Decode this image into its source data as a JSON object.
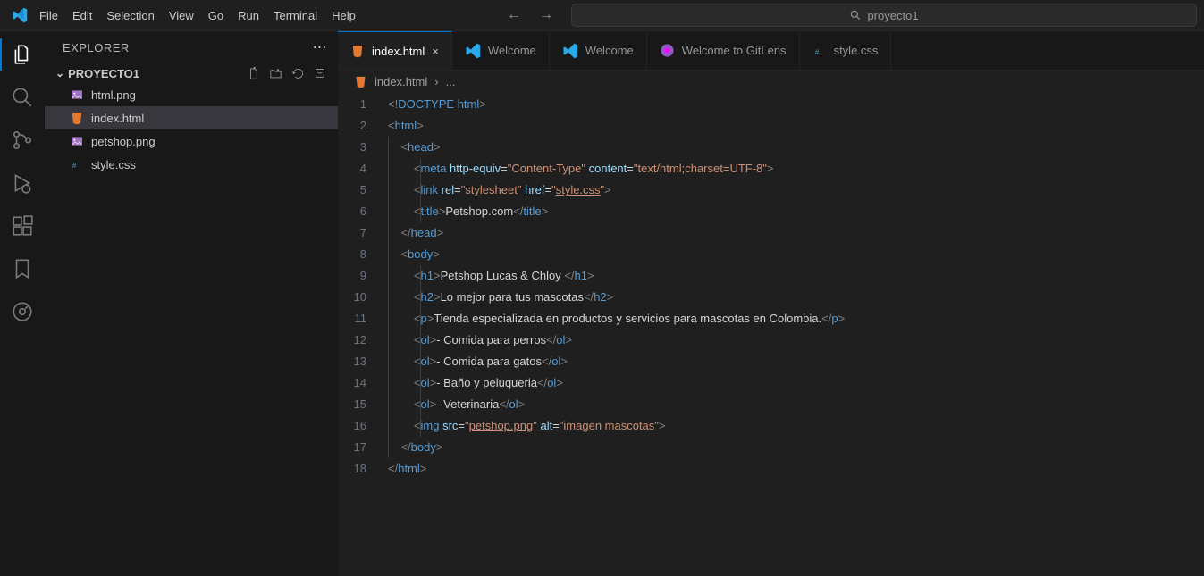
{
  "menu": [
    "File",
    "Edit",
    "Selection",
    "View",
    "Go",
    "Run",
    "Terminal",
    "Help"
  ],
  "search": {
    "placeholder": "proyecto1"
  },
  "sidebar": {
    "title": "EXPLORER",
    "folder": "PROYECTO1",
    "files": [
      {
        "name": "html.png",
        "icon": "image"
      },
      {
        "name": "index.html",
        "icon": "html",
        "selected": true
      },
      {
        "name": "petshop.png",
        "icon": "image"
      },
      {
        "name": "style.css",
        "icon": "css"
      }
    ]
  },
  "tabs": [
    {
      "label": "index.html",
      "icon": "html",
      "active": true,
      "close": true
    },
    {
      "label": "Welcome",
      "icon": "vscode"
    },
    {
      "label": "Welcome",
      "icon": "vscode"
    },
    {
      "label": "Welcome to GitLens",
      "icon": "gitlens"
    },
    {
      "label": "style.css",
      "icon": "css"
    }
  ],
  "breadcrumb": {
    "file": "index.html",
    "sep": "›",
    "more": "..."
  },
  "code": {
    "lines": [
      {
        "n": 1,
        "i": 0,
        "seg": [
          [
            "<!",
            "gray"
          ],
          [
            "DOCTYPE",
            "blue"
          ],
          [
            " ",
            "txt"
          ],
          [
            "html",
            "blue"
          ],
          [
            ">",
            "gray"
          ]
        ]
      },
      {
        "n": 2,
        "i": 0,
        "seg": [
          [
            "<",
            "gray"
          ],
          [
            "html",
            "blue"
          ],
          [
            ">",
            "gray"
          ]
        ]
      },
      {
        "n": 3,
        "i": 1,
        "seg": [
          [
            "<",
            "gray"
          ],
          [
            "head",
            "blue"
          ],
          [
            ">",
            "gray"
          ]
        ]
      },
      {
        "n": 4,
        "i": 2,
        "seg": [
          [
            "<",
            "gray"
          ],
          [
            "meta",
            "blue"
          ],
          [
            " ",
            "txt"
          ],
          [
            "http-equiv",
            "attr"
          ],
          [
            "=",
            "txt"
          ],
          [
            "\"Content-Type\"",
            "str"
          ],
          [
            " ",
            "txt"
          ],
          [
            "content",
            "attr"
          ],
          [
            "=",
            "txt"
          ],
          [
            "\"text/html;charset=UTF-8\"",
            "str"
          ],
          [
            ">",
            "gray"
          ]
        ]
      },
      {
        "n": 5,
        "i": 2,
        "seg": [
          [
            "<",
            "gray"
          ],
          [
            "link",
            "blue"
          ],
          [
            " ",
            "txt"
          ],
          [
            "rel",
            "attr"
          ],
          [
            "=",
            "txt"
          ],
          [
            "\"stylesheet\"",
            "str"
          ],
          [
            " ",
            "txt"
          ],
          [
            "href",
            "attr"
          ],
          [
            "=",
            "txt"
          ],
          [
            "\"",
            "str"
          ],
          [
            "style.css",
            "link"
          ],
          [
            "\"",
            "str"
          ],
          [
            ">",
            "gray"
          ]
        ]
      },
      {
        "n": 6,
        "i": 2,
        "seg": [
          [
            "<",
            "gray"
          ],
          [
            "title",
            "blue"
          ],
          [
            ">",
            "gray"
          ],
          [
            "Petshop.com",
            "txt"
          ],
          [
            "</",
            "gray"
          ],
          [
            "title",
            "blue"
          ],
          [
            ">",
            "gray"
          ]
        ]
      },
      {
        "n": 7,
        "i": 1,
        "seg": [
          [
            "</",
            "gray"
          ],
          [
            "head",
            "blue"
          ],
          [
            ">",
            "gray"
          ]
        ]
      },
      {
        "n": 8,
        "i": 1,
        "seg": [
          [
            "<",
            "gray"
          ],
          [
            "body",
            "blue"
          ],
          [
            ">",
            "gray"
          ]
        ]
      },
      {
        "n": 9,
        "i": 2,
        "seg": [
          [
            "<",
            "gray"
          ],
          [
            "h1",
            "blue"
          ],
          [
            ">",
            "gray"
          ],
          [
            "Petshop Lucas & Chloy ",
            "txt"
          ],
          [
            "</",
            "gray"
          ],
          [
            "h1",
            "blue"
          ],
          [
            ">",
            "gray"
          ]
        ]
      },
      {
        "n": 10,
        "i": 2,
        "seg": [
          [
            "<",
            "gray"
          ],
          [
            "h2",
            "blue"
          ],
          [
            ">",
            "gray"
          ],
          [
            "Lo mejor para tus mascotas",
            "txt"
          ],
          [
            "</",
            "gray"
          ],
          [
            "h2",
            "blue"
          ],
          [
            ">",
            "gray"
          ]
        ]
      },
      {
        "n": 11,
        "i": 2,
        "seg": [
          [
            "<",
            "gray"
          ],
          [
            "p",
            "blue"
          ],
          [
            ">",
            "gray"
          ],
          [
            "Tienda especializada en productos y servicios para mascotas en Colombia.",
            "txt"
          ],
          [
            "</",
            "gray"
          ],
          [
            "p",
            "blue"
          ],
          [
            ">",
            "gray"
          ]
        ]
      },
      {
        "n": 12,
        "i": 2,
        "seg": [
          [
            "<",
            "gray"
          ],
          [
            "ol",
            "blue"
          ],
          [
            ">",
            "gray"
          ],
          [
            "- Comida para perros",
            "txt"
          ],
          [
            "</",
            "gray"
          ],
          [
            "ol",
            "blue"
          ],
          [
            ">",
            "gray"
          ]
        ]
      },
      {
        "n": 13,
        "i": 2,
        "seg": [
          [
            "<",
            "gray"
          ],
          [
            "ol",
            "blue"
          ],
          [
            ">",
            "gray"
          ],
          [
            "- Comida para gatos",
            "txt"
          ],
          [
            "</",
            "gray"
          ],
          [
            "ol",
            "blue"
          ],
          [
            ">",
            "gray"
          ]
        ]
      },
      {
        "n": 14,
        "i": 2,
        "seg": [
          [
            "<",
            "gray"
          ],
          [
            "ol",
            "blue"
          ],
          [
            ">",
            "gray"
          ],
          [
            "- Baño y peluqueria",
            "txt"
          ],
          [
            "</",
            "gray"
          ],
          [
            "ol",
            "blue"
          ],
          [
            ">",
            "gray"
          ]
        ]
      },
      {
        "n": 15,
        "i": 2,
        "seg": [
          [
            "<",
            "gray"
          ],
          [
            "ol",
            "blue"
          ],
          [
            ">",
            "gray"
          ],
          [
            "- Veterinaria",
            "txt"
          ],
          [
            "</",
            "gray"
          ],
          [
            "ol",
            "blue"
          ],
          [
            ">",
            "gray"
          ]
        ]
      },
      {
        "n": 16,
        "i": 2,
        "seg": [
          [
            "<",
            "gray"
          ],
          [
            "img",
            "blue"
          ],
          [
            " ",
            "txt"
          ],
          [
            "src",
            "attr"
          ],
          [
            "=",
            "txt"
          ],
          [
            "\"",
            "str"
          ],
          [
            "petshop.png",
            "link"
          ],
          [
            "\"",
            "str"
          ],
          [
            " ",
            "txt"
          ],
          [
            "alt",
            "attr"
          ],
          [
            "=",
            "txt"
          ],
          [
            "\"imagen mascotas\"",
            "str"
          ],
          [
            ">",
            "gray"
          ]
        ]
      },
      {
        "n": 17,
        "i": 1,
        "seg": [
          [
            "</",
            "gray"
          ],
          [
            "body",
            "blue"
          ],
          [
            ">",
            "gray"
          ]
        ]
      },
      {
        "n": 18,
        "i": 0,
        "seg": [
          [
            "</",
            "gray"
          ],
          [
            "html",
            "blue"
          ],
          [
            ">",
            "gray"
          ]
        ]
      }
    ]
  }
}
